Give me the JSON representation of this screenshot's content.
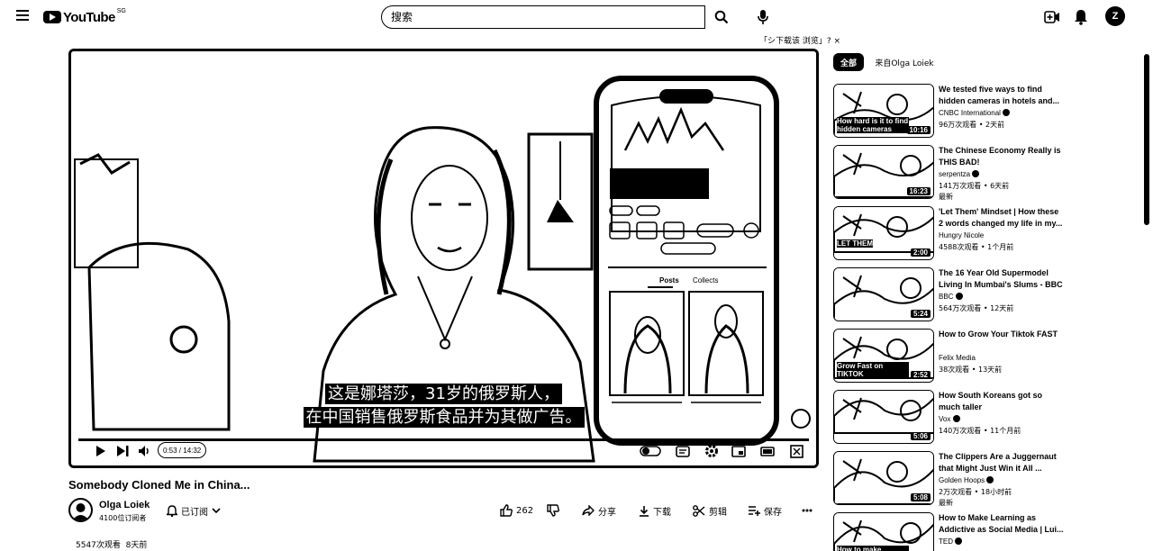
{
  "header": {
    "logo_text": "YouTube",
    "region": "SG",
    "search_placeholder": "搜索",
    "avatar_letter": "Z",
    "input_hint": "「シ下载该 浏览」? ×"
  },
  "player": {
    "subtitle_line1": "这是娜塔莎，31岁的俄罗斯人，",
    "subtitle_line2": "在中国销售俄罗斯食品并为其做广告。",
    "time": "0:53 / 14:32",
    "phone": {
      "tab_posts": "Posts",
      "tab_collects": "Collects"
    }
  },
  "video": {
    "title": "Somebody Cloned Me in China...",
    "channel_name": "Olga Loiek",
    "channel_subs": "4100位订阅者",
    "subscribe_label": "已订阅",
    "likes": "262",
    "share_label": "分享",
    "download_label": "下载",
    "clip_label": "剪辑",
    "save_label": "保存",
    "views": "5547次观看",
    "age": "8天前"
  },
  "sidebar": {
    "chip_all": "全部",
    "chip_from": "来自Olga Loiek",
    "items": [
      {
        "title": "We tested five ways to find hidden cameras in hotels and...",
        "channel": "CNBC International",
        "verified": true,
        "views": "96万次观看",
        "age": "2天前",
        "duration": "10:16",
        "new": "",
        "thumb_caption": "How hard is it to find hidden cameras"
      },
      {
        "title": "The Chinese Economy Really is THIS BAD!",
        "channel": "serpentza",
        "verified": true,
        "views": "141万次观看",
        "age": "6天前",
        "duration": "16:23",
        "new": "最新",
        "thumb_caption": ""
      },
      {
        "title": "'Let Them' Mindset | How these 2 words changed my life in my...",
        "channel": "Hungry Nicole",
        "verified": false,
        "views": "4588次观看",
        "age": "1个月前",
        "duration": "2:00",
        "new": "",
        "thumb_caption": "LET THEM"
      },
      {
        "title": "The 16 Year Old Supermodel Living In Mumbai's Slums - BBC",
        "channel": "BBC",
        "verified": true,
        "views": "564万次观看",
        "age": "12天前",
        "duration": "5:24",
        "new": "",
        "thumb_caption": ""
      },
      {
        "title": "How to Grow Your Tiktok FAST",
        "channel": "Felix Media",
        "verified": false,
        "views": "38次观看",
        "age": "13天前",
        "duration": "2:52",
        "new": "",
        "thumb_caption": "Grow Fast on TIKTOK"
      },
      {
        "title": "How South Koreans got so much taller",
        "channel": "Vox",
        "verified": true,
        "views": "140万次观看",
        "age": "11个月前",
        "duration": "5:06",
        "new": "",
        "thumb_caption": ""
      },
      {
        "title": "The Clippers Are a Juggernaut that Might Just Win it All ...",
        "channel": "Golden Hoops",
        "verified": true,
        "views": "2万次观看",
        "age": "18小时前",
        "duration": "5:08",
        "new": "最新",
        "thumb_caption": ""
      },
      {
        "title": "How to Make Learning as Addictive as Social Media | Lui...",
        "channel": "TED",
        "verified": true,
        "views": "",
        "age": "",
        "duration": "",
        "new": "",
        "thumb_caption": "How to make learning as addictive as social media"
      }
    ]
  }
}
